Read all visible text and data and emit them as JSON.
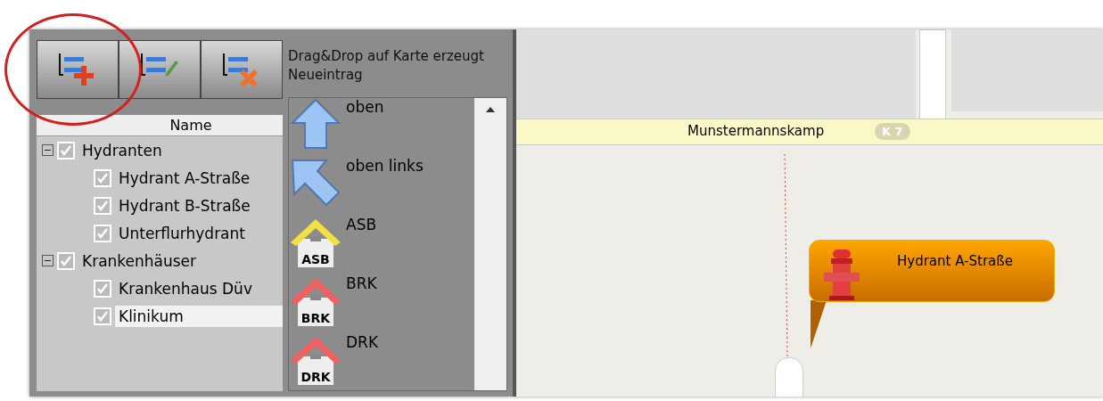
{
  "toolbar": {
    "buttons": [
      {
        "kind": "add"
      },
      {
        "kind": "edit"
      },
      {
        "kind": "delete"
      }
    ],
    "annotation": {
      "kind": "circle"
    },
    "hint": "Drag&Drop auf Karte erzeugt Neueintrag"
  },
  "tree": {
    "column": "Name",
    "items": [
      {
        "label": "Hydranten",
        "checked": true,
        "expanded": true,
        "selected": false,
        "children": [
          {
            "label": "Hydrant A-Straße",
            "checked": true,
            "selected": false
          },
          {
            "label": "Hydrant B-Straße",
            "checked": true,
            "selected": false
          },
          {
            "label": "Unterflurhydrant",
            "checked": true,
            "selected": false
          }
        ]
      },
      {
        "label": "Krankenhäuser",
        "checked": true,
        "expanded": true,
        "selected": false,
        "children": [
          {
            "label": "Krankenhaus Düv",
            "checked": true,
            "selected": false
          },
          {
            "label": "Klinikum",
            "checked": true,
            "selected": true
          }
        ]
      }
    ]
  },
  "symbols": [
    {
      "label": "oben",
      "kind": "arrow-up"
    },
    {
      "label": "oben links",
      "kind": "arrow-upleft"
    },
    {
      "label": "ASB",
      "kind": "house",
      "badge": "ASB",
      "color": "#f0e040"
    },
    {
      "label": "BRK",
      "kind": "house",
      "badge": "BRK",
      "color": "#f06060"
    },
    {
      "label": "DRK",
      "kind": "house",
      "badge": "DRK",
      "color": "#f06060"
    }
  ],
  "map": {
    "road": "Munstermannskamp",
    "road_number": "K 7",
    "marker": {
      "label": "Hydrant A-Straße"
    }
  }
}
